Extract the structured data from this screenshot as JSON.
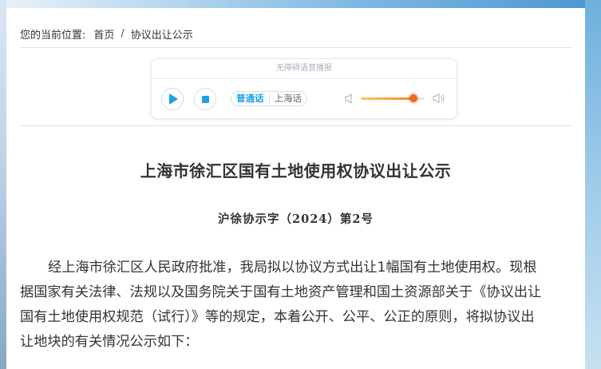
{
  "breadcrumb": {
    "prefix": "您的当前位置:",
    "home": "首页",
    "separator": "/",
    "current": "协议出让公示"
  },
  "player": {
    "header": "无障碍语音播报",
    "languages": [
      "普通话",
      "上海话"
    ],
    "selected_language": "普通话",
    "volume_fraction": 0.82,
    "accent_color": "#1aa3e8",
    "volume_color": "#ef6a1c"
  },
  "notice": {
    "title": "上海市徐汇区国有土地使用权协议出让公示",
    "doc_number": "沪徐协示字（2024）第2号",
    "body_lines": [
      "经上海市徐汇区人民政府批准，我局拟以协议方式出让1幅国有土地使用权。现根",
      "据国家有关法律、法规以及国务院关于国有土地资产管理和国土资源部关于《协议出让",
      "国有土地使用权规范（试行）》等的规定，本着公开、公平、公正的原则，将拟协议出",
      "让地块的有关情况公示如下："
    ]
  }
}
